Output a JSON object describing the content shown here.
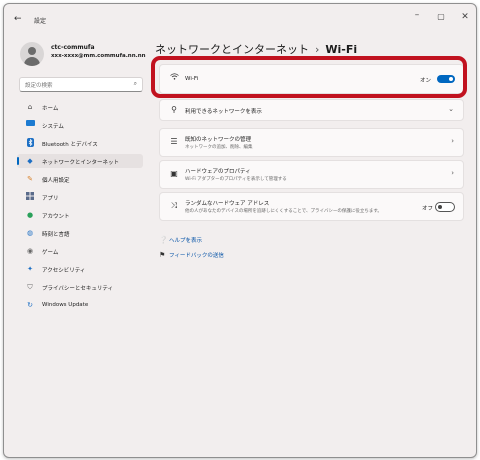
{
  "app_title": "設定",
  "profile": {
    "name": "ctc-commufa",
    "email": "xxx-xxxx@mm.commufa.nn.nn"
  },
  "search": {
    "placeholder": "設定の検索"
  },
  "nav": [
    {
      "label": "ホーム",
      "icon": "home-icon"
    },
    {
      "label": "システム",
      "icon": "system-icon"
    },
    {
      "label": "Bluetooth とデバイス",
      "icon": "bluetooth-icon"
    },
    {
      "label": "ネットワークとインターネット",
      "icon": "network-icon",
      "selected": true
    },
    {
      "label": "個人用設定",
      "icon": "brush-icon"
    },
    {
      "label": "アプリ",
      "icon": "apps-icon"
    },
    {
      "label": "アカウント",
      "icon": "account-icon"
    },
    {
      "label": "時刻と言語",
      "icon": "time-language-icon"
    },
    {
      "label": "ゲーム",
      "icon": "gaming-icon"
    },
    {
      "label": "アクセシビリティ",
      "icon": "accessibility-icon"
    },
    {
      "label": "プライバシーとセキュリティ",
      "icon": "shield-icon"
    },
    {
      "label": "Windows Update",
      "icon": "update-icon"
    }
  ],
  "breadcrumb": {
    "parent": "ネットワークとインターネット",
    "separator": "›",
    "current": "Wi-Fi"
  },
  "wifi": {
    "label": "Wi-Fi",
    "state": "オン",
    "on": true
  },
  "cards": {
    "available": {
      "title": "利用できるネットワークを表示"
    },
    "known": {
      "title": "既知のネットワークの管理",
      "sub": "ネットワークの追加、削除、編集"
    },
    "hardware": {
      "title": "ハードウェアのプロパティ",
      "sub": "Wi-Fi アダプターのプロパティを表示して管理する"
    },
    "random": {
      "title": "ランダムなハードウェア アドレス",
      "sub": "他の人があなたのデバイスの場所を追跡しにくくすることで、プライバシーの保護に役立ちます。",
      "state": "オフ",
      "on": false
    }
  },
  "links": {
    "help": "ヘルプを表示",
    "feedback": "フィードバックの送信"
  },
  "colors": {
    "accent": "#0067c0",
    "highlight": "#c1121f"
  }
}
